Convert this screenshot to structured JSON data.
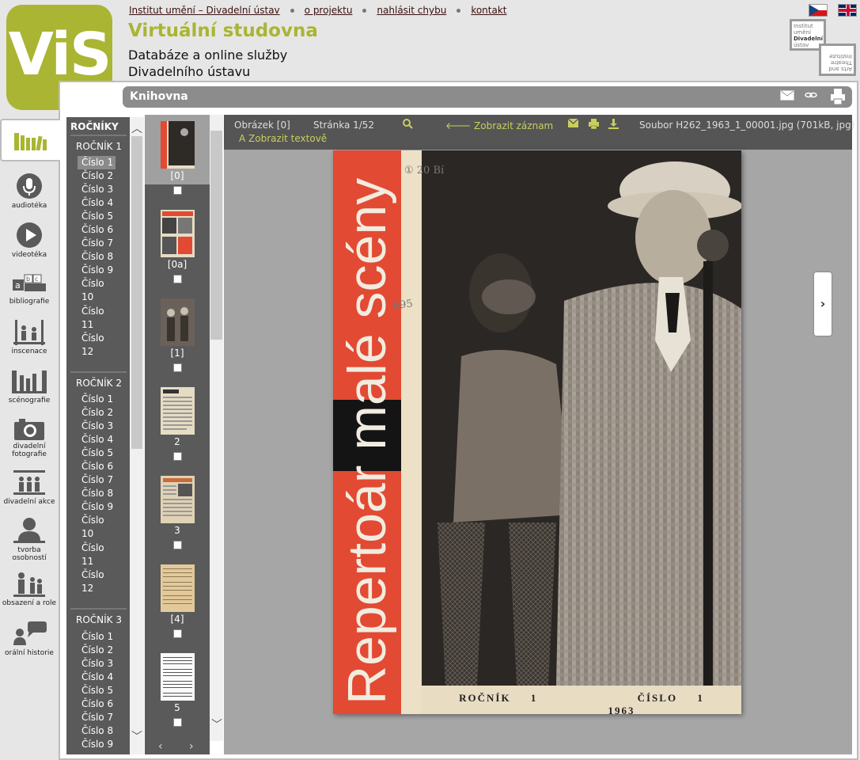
{
  "header": {
    "logo_text": "ViS",
    "links": [
      "Institut umění – Divadelní ústav",
      "o projektu",
      "nahlásit chybu",
      "kontakt"
    ],
    "title": "Virtuální studovna",
    "subtitle_line1": "Databáze a online služby",
    "subtitle_line2": "Divadelního ústavu",
    "idu_logo": {
      "line1": "Institut",
      "line2": "umění",
      "line3": "Divadelní",
      "line4": "ústav",
      "r1": "Arts and",
      "r2": "Theatre",
      "r3": "Institute"
    }
  },
  "section": {
    "title": "Knihovna"
  },
  "sidenav": [
    {
      "label": "audiotéka"
    },
    {
      "label": "videotéka"
    },
    {
      "label": "bibliografie"
    },
    {
      "label": "inscenace"
    },
    {
      "label": "scénografie"
    },
    {
      "label": "divadelní fotografie"
    },
    {
      "label": "divadelní akce"
    },
    {
      "label": "tvorba osobností"
    },
    {
      "label": "obsazení a role"
    },
    {
      "label": "orální historie"
    }
  ],
  "volumes": {
    "heading": "ROČNÍKY",
    "groups": [
      {
        "title": "ROČNÍK 1",
        "issues": [
          "Číslo 1",
          "Číslo 2",
          "Číslo 3",
          "Číslo 4",
          "Číslo 5",
          "Číslo 6",
          "Číslo 7",
          "Číslo 8",
          "Číslo 9",
          "Číslo 10",
          "Číslo 11",
          "Číslo 12"
        ]
      },
      {
        "title": "ROČNÍK 2",
        "issues": [
          "Číslo 1",
          "Číslo 2",
          "Číslo 3",
          "Číslo 4",
          "Číslo 5",
          "Číslo 6",
          "Číslo 7",
          "Číslo 8",
          "Číslo 9",
          "Číslo 10",
          "Číslo 11",
          "Číslo 12"
        ]
      },
      {
        "title": "ROČNÍK 3",
        "issues": [
          "Číslo 1",
          "Číslo 2",
          "Číslo 3",
          "Číslo 4",
          "Číslo 5",
          "Číslo 6",
          "Číslo 7",
          "Číslo 8",
          "Číslo 9"
        ]
      }
    ]
  },
  "thumbnails": [
    "[0]",
    "[0a]",
    "[1]",
    "2",
    "3",
    "[4]",
    "5"
  ],
  "viewer": {
    "image_label": "Obrázek [0]",
    "page_label": "Stránka 1/52",
    "show_record": "Zobrazit záznam",
    "show_text": "Zobrazit textově",
    "file_info": "Soubor H262_1963_1_00001.jpg (701kB, jpg)"
  },
  "cover": {
    "title": "Repertoár malé scény",
    "footer_vol": "ROČNÍK 1",
    "footer_issue": "ČÍSLO 1",
    "footer_year": "1963",
    "pencil_notes": "① 20 Bí",
    "pencil_number": "695"
  },
  "colors": {
    "accent": "#a9b533",
    "panel": "#5a5a5a",
    "cover_red": "#e24a33"
  }
}
